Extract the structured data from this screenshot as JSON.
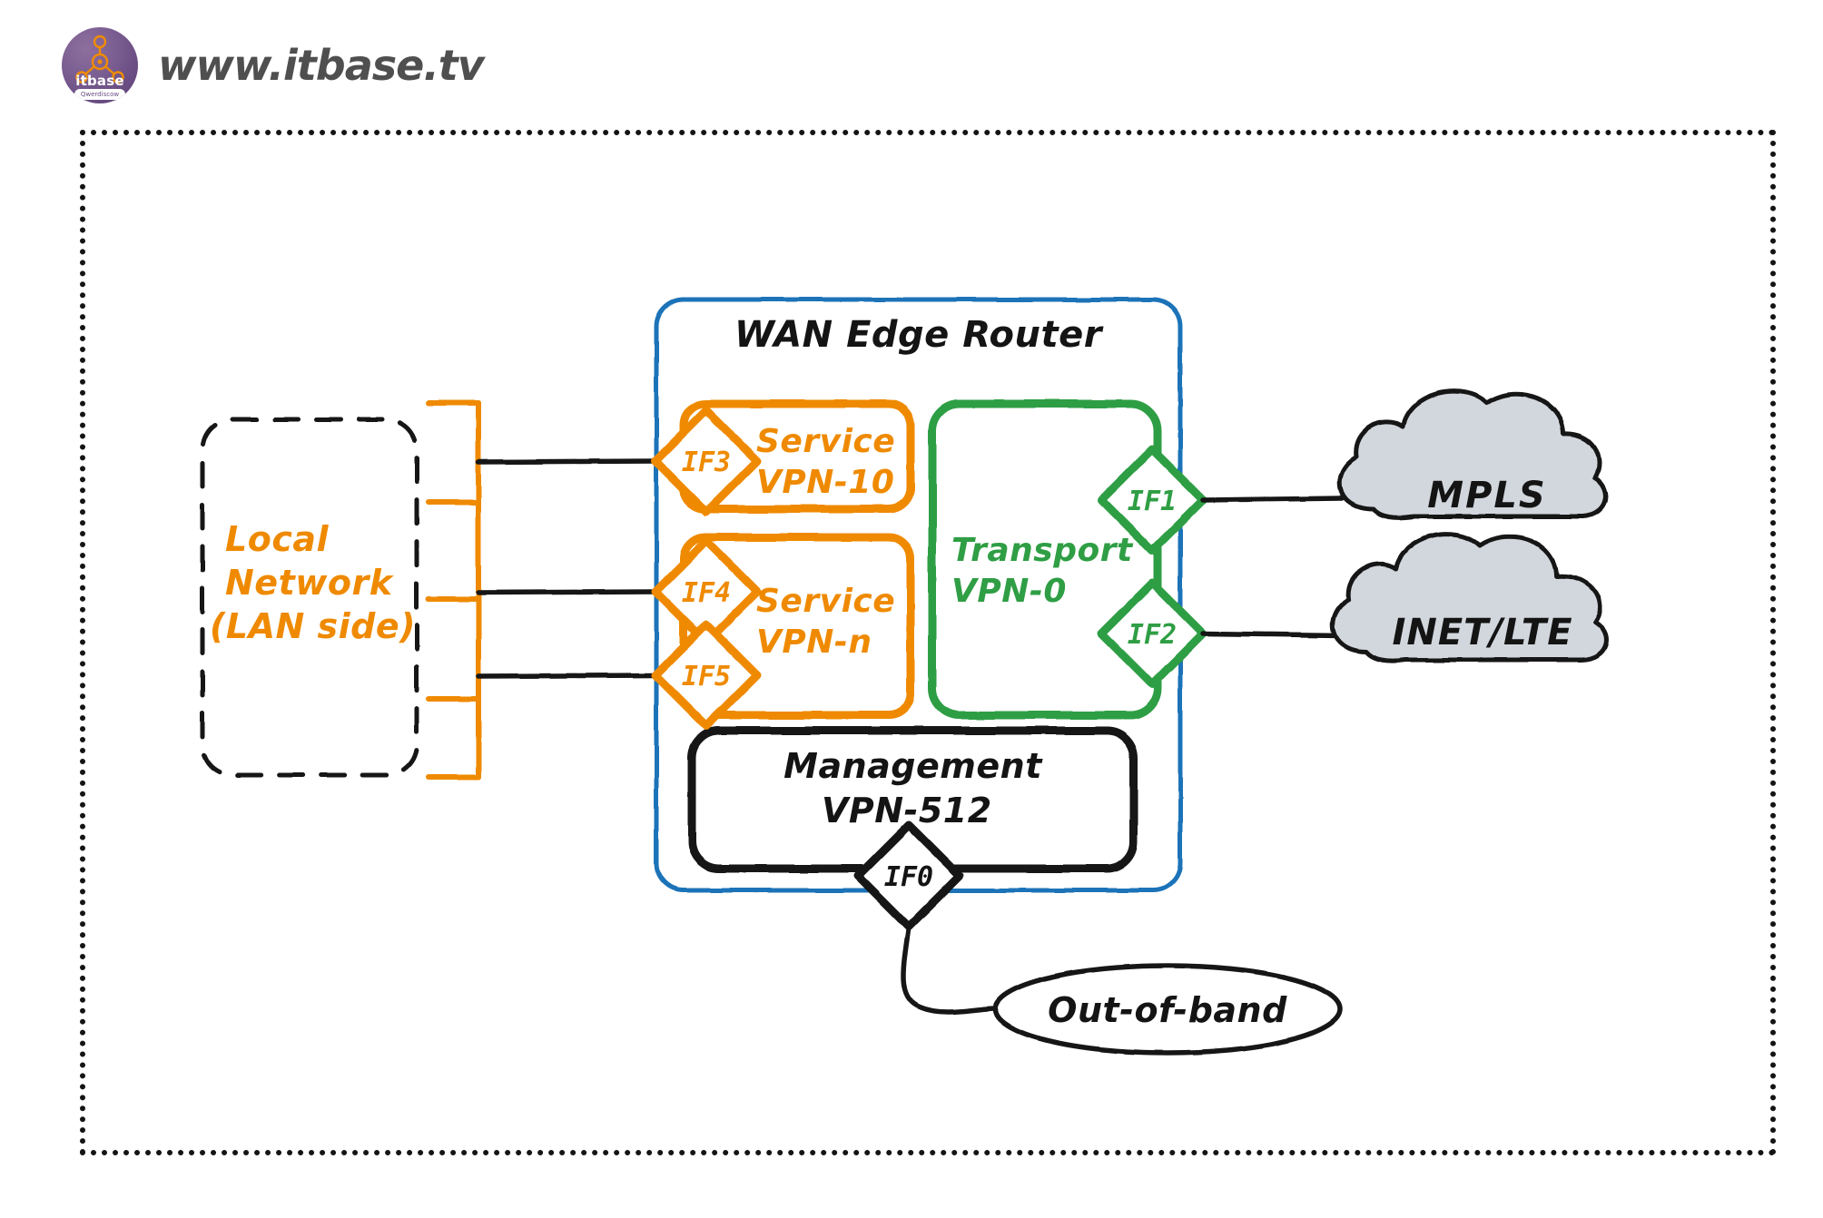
{
  "brand": {
    "logo_icon": "itbase-network-logo-icon",
    "logo_name": "itbase",
    "logo_sub": "Qwerdiscow",
    "url": "www.itbase.tv"
  },
  "diagram": {
    "title": "WAN Edge Router",
    "lan": {
      "line1": "Local",
      "line2": "Network",
      "line3": "(LAN side)"
    },
    "vpns": [
      {
        "id": "service-vpn-10",
        "line1": "Service",
        "line2": "VPN-10",
        "color": "#ef8a00"
      },
      {
        "id": "service-vpn-n",
        "line1": "Service",
        "line2": "VPN-n",
        "color": "#ef8a00"
      },
      {
        "id": "transport-vpn-0",
        "line1": "Transport",
        "line2": "VPN-0",
        "color": "#2f9e44"
      },
      {
        "id": "management-vpn-512",
        "line1": "Management",
        "line2": "VPN-512",
        "color": "#141414"
      }
    ],
    "interfaces": [
      {
        "name": "IF0",
        "color": "#141414",
        "zone": "management-vpn-512"
      },
      {
        "name": "IF1",
        "color": "#2f9e44",
        "zone": "transport-vpn-0"
      },
      {
        "name": "IF2",
        "color": "#2f9e44",
        "zone": "transport-vpn-0"
      },
      {
        "name": "IF3",
        "color": "#ef8a00",
        "zone": "service-vpn-10"
      },
      {
        "name": "IF4",
        "color": "#ef8a00",
        "zone": "service-vpn-n"
      },
      {
        "name": "IF5",
        "color": "#ef8a00",
        "zone": "service-vpn-n"
      }
    ],
    "clouds": [
      {
        "id": "mpls-cloud",
        "label": "MPLS"
      },
      {
        "id": "inet-lte-cloud",
        "label": "INET/LTE"
      }
    ],
    "oob": {
      "label": "Out-of-band"
    }
  },
  "colors": {
    "blue": "#1a73b8",
    "orange": "#ef8a00",
    "green": "#2f9e44",
    "black": "#141414",
    "cloud_fill": "#d2d7dd",
    "logo_purple": "#6a4d83"
  }
}
